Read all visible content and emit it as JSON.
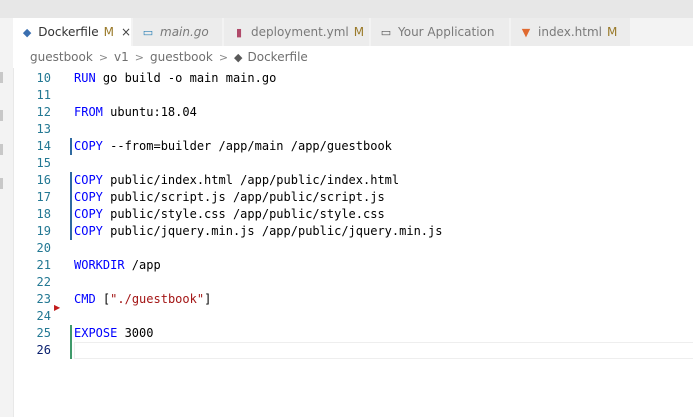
{
  "colors": {
    "keyword": "#0000ff",
    "string": "#a31515",
    "line_number": "#237893",
    "modified_gutter": "#2f6aa0",
    "added_gutter": "#3f9a6b",
    "deleted_marker": "#c21b1b"
  },
  "tabs": [
    {
      "name": "Dockerfile",
      "icon": "docker-icon",
      "badge": "M",
      "close": "×",
      "active": true,
      "italic": false
    },
    {
      "name": "main.go",
      "icon": "go-icon",
      "badge": "",
      "close": "",
      "active": false,
      "italic": true
    },
    {
      "name": "deployment.yml",
      "icon": "yaml-icon",
      "badge": "M",
      "close": "",
      "active": false,
      "italic": false
    },
    {
      "name": "Your Application",
      "icon": "browser-window-icon",
      "badge": "",
      "close": "",
      "active": false,
      "italic": false
    },
    {
      "name": "index.html",
      "icon": "html5-icon",
      "badge": "M",
      "close": "",
      "active": false,
      "italic": false
    }
  ],
  "breadcrumb": {
    "items": [
      "guestbook",
      "v1",
      "guestbook",
      "Dockerfile"
    ],
    "separator": ">"
  },
  "editor": {
    "lines": [
      {
        "num": "10",
        "keyword": "RUN",
        "rest": " go build -o main main.go",
        "string": "",
        "tail": "",
        "gutter": "none"
      },
      {
        "num": "11",
        "keyword": "",
        "rest": "",
        "string": "",
        "tail": "",
        "gutter": "none"
      },
      {
        "num": "12",
        "keyword": "FROM",
        "rest": " ubuntu:18.04",
        "string": "",
        "tail": "",
        "gutter": "none"
      },
      {
        "num": "13",
        "keyword": "",
        "rest": "",
        "string": "",
        "tail": "",
        "gutter": "none"
      },
      {
        "num": "14",
        "keyword": "COPY",
        "rest": " --from=builder /app/main /app/guestbook",
        "string": "",
        "tail": "",
        "gutter": "modified"
      },
      {
        "num": "15",
        "keyword": "",
        "rest": "",
        "string": "",
        "tail": "",
        "gutter": "none"
      },
      {
        "num": "16",
        "keyword": "COPY",
        "rest": " public/index.html /app/public/index.html",
        "string": "",
        "tail": "",
        "gutter": "modified"
      },
      {
        "num": "17",
        "keyword": "COPY",
        "rest": " public/script.js /app/public/script.js",
        "string": "",
        "tail": "",
        "gutter": "modified"
      },
      {
        "num": "18",
        "keyword": "COPY",
        "rest": " public/style.css /app/public/style.css",
        "string": "",
        "tail": "",
        "gutter": "modified"
      },
      {
        "num": "19",
        "keyword": "COPY",
        "rest": " public/jquery.min.js /app/public/jquery.min.js",
        "string": "",
        "tail": "",
        "gutter": "modified"
      },
      {
        "num": "20",
        "keyword": "",
        "rest": "",
        "string": "",
        "tail": "",
        "gutter": "none"
      },
      {
        "num": "21",
        "keyword": "WORKDIR",
        "rest": " /app",
        "string": "",
        "tail": "",
        "gutter": "none"
      },
      {
        "num": "22",
        "keyword": "",
        "rest": "",
        "string": "",
        "tail": "",
        "gutter": "none"
      },
      {
        "num": "23",
        "keyword": "CMD",
        "rest": " [",
        "string": "\"./guestbook\"",
        "tail": "]",
        "gutter": "none"
      },
      {
        "num": "24",
        "keyword": "",
        "rest": "",
        "string": "",
        "tail": "",
        "gutter": "deleted"
      },
      {
        "num": "25",
        "keyword": "EXPOSE",
        "rest": " 3000",
        "string": "",
        "tail": "",
        "gutter": "added"
      },
      {
        "num": "26",
        "keyword": "",
        "rest": "",
        "string": "",
        "tail": "",
        "gutter": "added",
        "current": true
      }
    ]
  }
}
